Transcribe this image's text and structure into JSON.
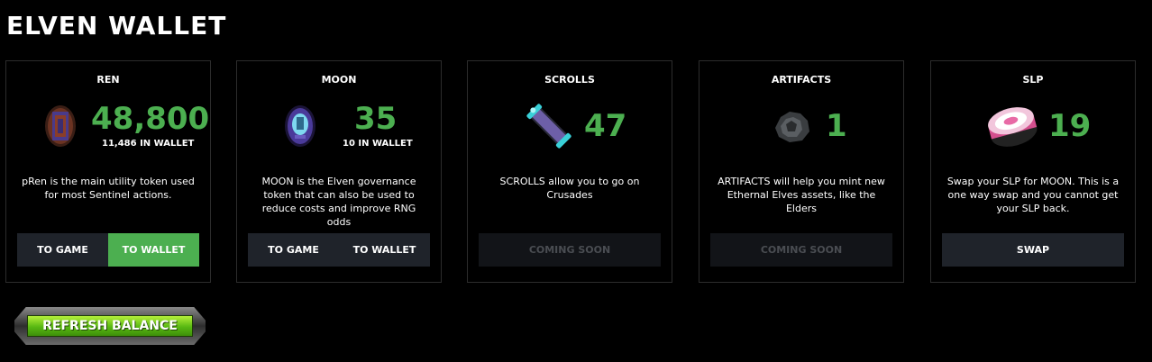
{
  "page": {
    "title": "ELVEN WALLET"
  },
  "cards": [
    {
      "name": "REN",
      "amount": "48,800",
      "wallet": "11,486 IN WALLET",
      "description": "pRen is the main utility token used for most Sentinel actions.",
      "icon": "ren-token-icon",
      "buttons": [
        {
          "label": "TO GAME",
          "style": "dark"
        },
        {
          "label": "TO WALLET",
          "style": "green"
        }
      ]
    },
    {
      "name": "MOON",
      "amount": "35",
      "wallet": "10 IN WALLET",
      "description": "MOON is the Elven governance token that can also be used to reduce costs and improve RNG odds",
      "icon": "moon-token-icon",
      "buttons": [
        {
          "label": "TO GAME",
          "style": "dark"
        },
        {
          "label": "TO WALLET",
          "style": "dark"
        }
      ]
    },
    {
      "name": "SCROLLS",
      "amount": "47",
      "description": "SCROLLS allow you to go on Crusades",
      "icon": "scroll-icon",
      "buttons": [
        {
          "label": "COMING SOON",
          "style": "disabled"
        }
      ]
    },
    {
      "name": "ARTIFACTS",
      "amount": "1",
      "description": "ARTIFACTS will help you mint new Ethernal Elves assets, like the Elders",
      "icon": "artifact-icon",
      "buttons": [
        {
          "label": "COMING SOON",
          "style": "disabled"
        }
      ]
    },
    {
      "name": "SLP",
      "amount": "19",
      "description": "Swap your SLP for MOON. This is a one way swap and you cannot get your SLP back.",
      "icon": "slp-token-icon",
      "buttons": [
        {
          "label": "SWAP",
          "style": "dark"
        }
      ]
    }
  ],
  "refresh": {
    "label": "REFRESH BALANCE"
  },
  "colors": {
    "accent": "#4caf50",
    "button_dark": "#1f232a",
    "button_disabled": "#121418",
    "border": "#2c2c2c"
  }
}
